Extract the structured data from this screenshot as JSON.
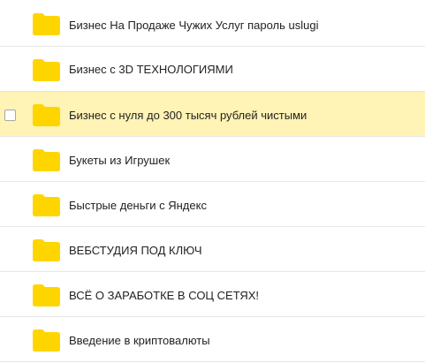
{
  "colors": {
    "folder": "#FFD500",
    "folder_tab": "#FFD500",
    "highlight_background": "#FFF3B5",
    "divider": "#E6E6E6",
    "text": "#222222"
  },
  "file_list": {
    "items": [
      {
        "name": "Бизнес На Продаже Чужих Услуг пароль uslugi",
        "icon": "folder-icon",
        "selected": false
      },
      {
        "name": "Бизнес с 3D ТЕХНОЛОГИЯМИ",
        "icon": "folder-icon",
        "selected": false
      },
      {
        "name": "Бизнес с нуля до 300 тысяч рублей чистыми",
        "icon": "folder-icon",
        "selected": false,
        "hovered": true
      },
      {
        "name": "Букеты из Игрушек",
        "icon": "folder-icon",
        "selected": false
      },
      {
        "name": "Быстрые деньги с Яндекс",
        "icon": "folder-icon",
        "selected": false
      },
      {
        "name": "ВЕБСТУДИЯ ПОД КЛЮЧ",
        "icon": "folder-icon",
        "selected": false
      },
      {
        "name": "ВСЁ О ЗАРАБОТКЕ В СОЦ СЕТЯХ!",
        "icon": "folder-icon",
        "selected": false
      },
      {
        "name": "Введение в криптовалюты",
        "icon": "folder-icon",
        "selected": false
      }
    ]
  }
}
